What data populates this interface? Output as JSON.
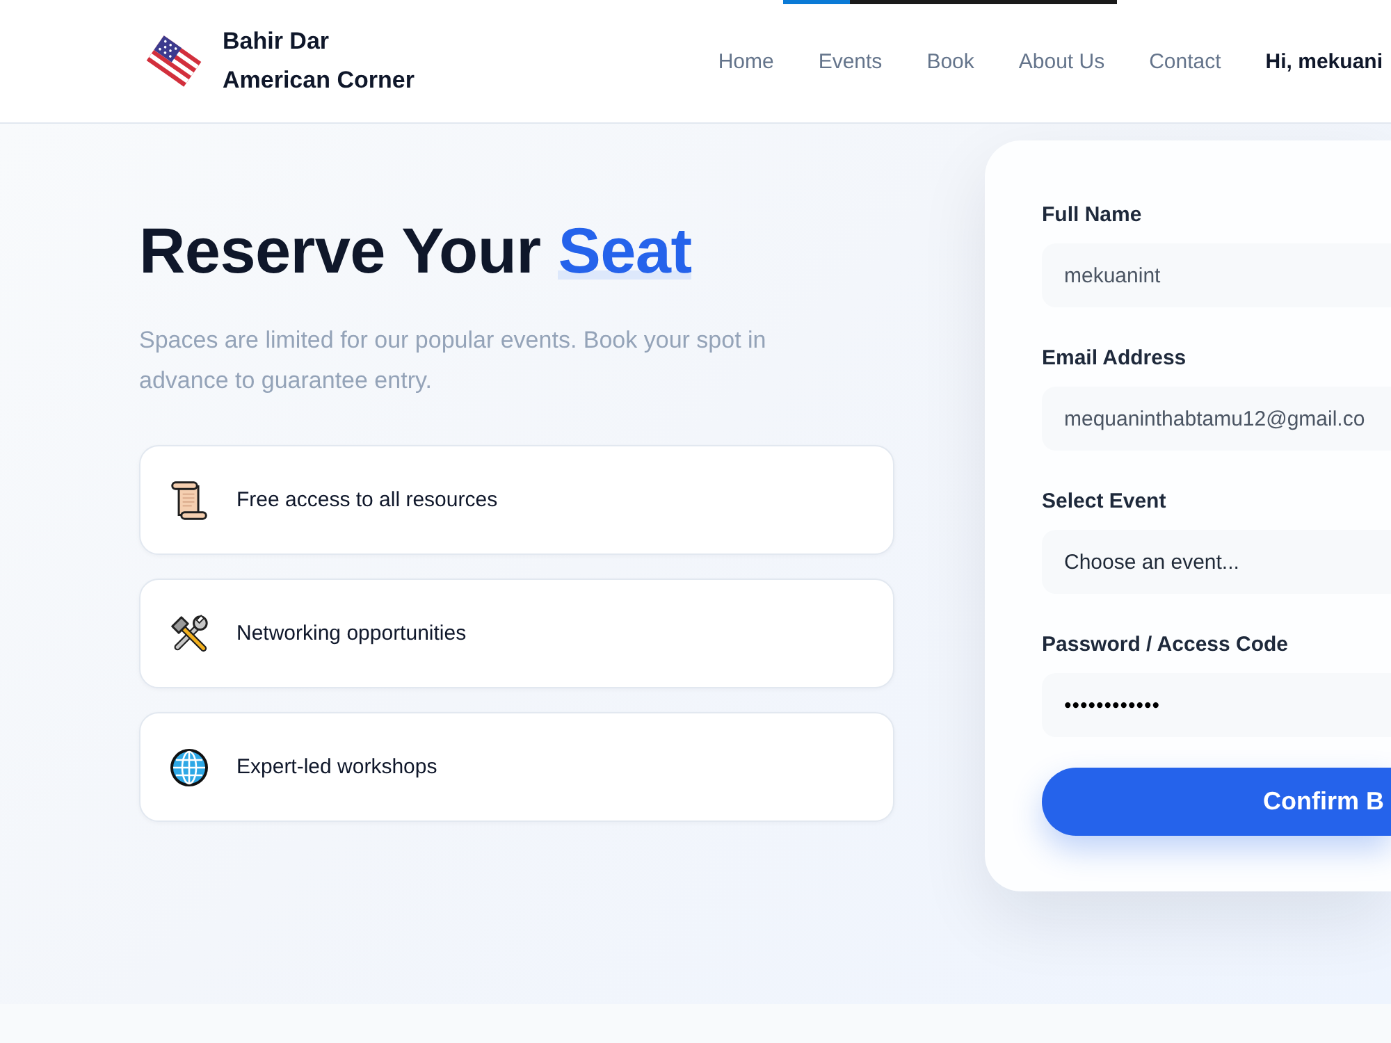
{
  "loading_bar": {
    "level": 0.2
  },
  "header": {
    "brand": "Bahir Dar American Corner",
    "nav": [
      {
        "label": "Home",
        "kind": "link"
      },
      {
        "label": "Events",
        "kind": "link"
      },
      {
        "label": "Book",
        "kind": "link"
      },
      {
        "label": "About Us",
        "kind": "link"
      },
      {
        "label": "Contact",
        "kind": "link"
      },
      {
        "label": "Hi, mekuani",
        "kind": "user"
      }
    ]
  },
  "hero": {
    "heading": {
      "text": "Reserve Your",
      "highlight": "Seat"
    },
    "description": "Spaces are limited for our popular events. Book your spot in advance to guarantee entry.",
    "features": [
      {
        "kind": "scroll",
        "label": "Free access to all resources"
      },
      {
        "kind": "tools",
        "label": "Networking opportunities"
      },
      {
        "kind": "globe",
        "label": "Expert-led workshops"
      }
    ]
  },
  "booking_form": {
    "fields": [
      {
        "label": "Full Name",
        "kind": "text",
        "value": "mekuanint"
      },
      {
        "label": "Email Address",
        "kind": "email",
        "value": "mequaninthabtamu12@gmail.co"
      },
      {
        "label": "Select Event",
        "kind": "select",
        "value": "Choose an event..."
      },
      {
        "label": "Password / Access Code",
        "kind": "password",
        "value": "••••••••••••"
      }
    ],
    "submit": "Confirm B"
  }
}
